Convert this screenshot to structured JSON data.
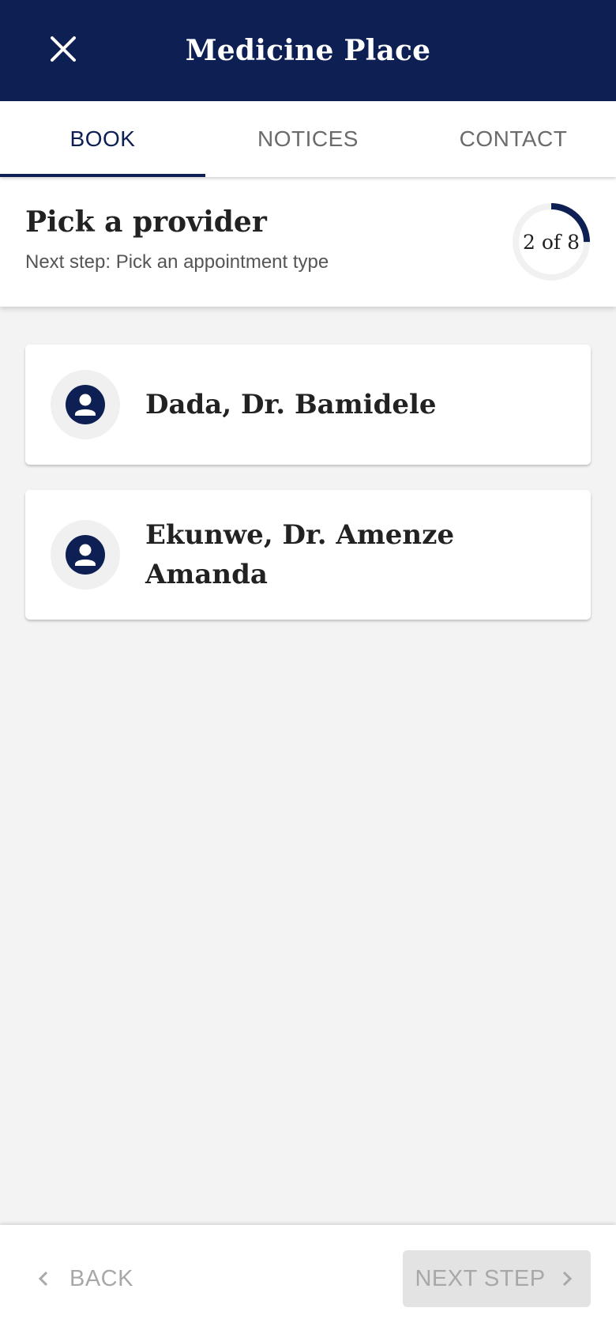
{
  "app": {
    "title": "Medicine Place",
    "close_icon": "close-icon",
    "colors": {
      "primary": "#0e1f54",
      "background": "#f3f3f3",
      "disabled": "#a8a8a8"
    }
  },
  "tabs": [
    {
      "label": "BOOK",
      "active": true
    },
    {
      "label": "NOTICES",
      "active": false
    },
    {
      "label": "CONTACT",
      "active": false
    }
  ],
  "step": {
    "title": "Pick a provider",
    "subtitle": "Next step: Pick an appointment type",
    "progress_label": "2 of 8",
    "current": 2,
    "total": 8
  },
  "providers": [
    {
      "name": "Dada, Dr. Bamidele",
      "icon": "person-icon"
    },
    {
      "name": "Ekunwe, Dr. Amenze Amanda",
      "icon": "person-icon"
    }
  ],
  "footer": {
    "back_label": "BACK",
    "next_label": "NEXT STEP",
    "next_enabled": false
  }
}
